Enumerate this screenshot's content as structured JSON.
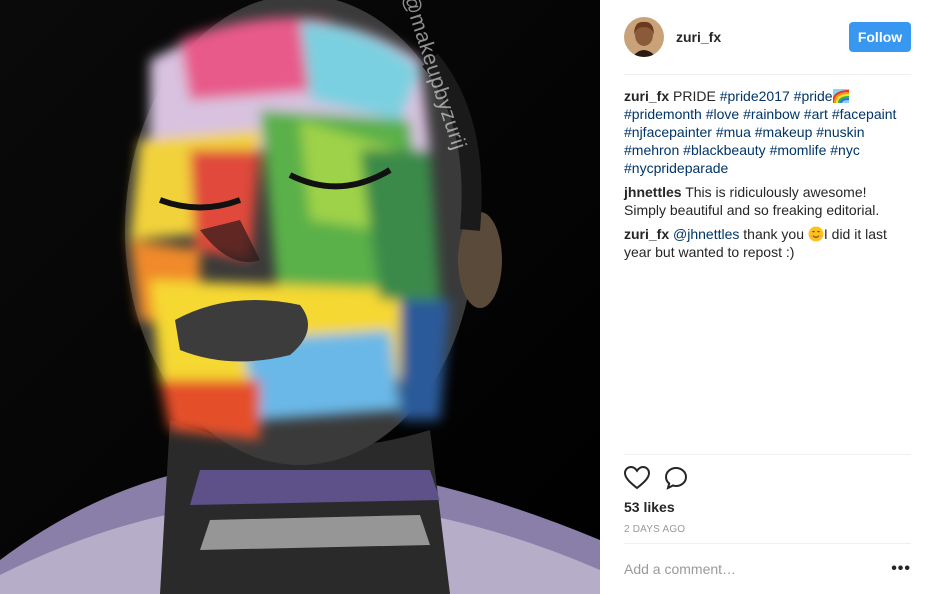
{
  "post": {
    "username": "zuri_fx",
    "follow_label": "Follow",
    "watermark": "@makeupbyzurij",
    "caption": {
      "author": "zuri_fx",
      "text": "PRIDE",
      "hashtags": [
        "#pride2017",
        "#pride",
        "#pridemonth",
        "#love",
        "#rainbow",
        "#art",
        "#facepaint",
        "#njfacepainter",
        "#mua",
        "#makeup",
        "#nuskin",
        "#mehron",
        "#blackbeauty",
        "#momlife",
        "#nyc",
        "#nycprideparade"
      ]
    },
    "comments": [
      {
        "author": "jhnettles",
        "text": "This is ridiculously awesome! Simply beautiful and so freaking editorial."
      },
      {
        "author": "zuri_fx",
        "mention": "@jhnettles",
        "text_before_emoji": "thank you",
        "text_after_emoji": "I did it last year but wanted to repost :)"
      }
    ],
    "likes": "53 likes",
    "timestamp": "2 DAYS AGO",
    "comment_placeholder": "Add a comment…",
    "more_label": "•••"
  },
  "icons": {
    "like": "heart-icon",
    "comment": "comment-bubble-icon",
    "emoji_rainbow": "rainbow-emoji-icon",
    "emoji_smile": "smile-emoji-icon"
  },
  "colors": {
    "follow_button": "#3897f0",
    "hashtag": "#003569",
    "muted": "#999999"
  }
}
